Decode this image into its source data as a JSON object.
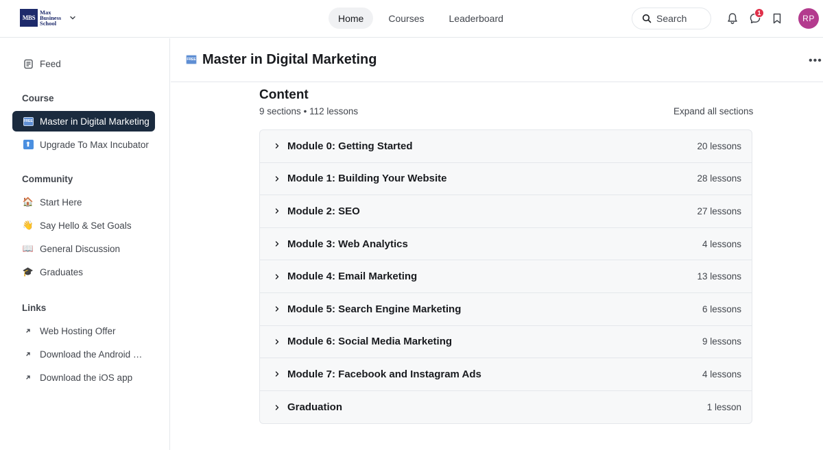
{
  "brand": {
    "logo_abbr": "MBS",
    "logo_text": "Max Business School"
  },
  "nav": {
    "items": [
      "Home",
      "Courses",
      "Leaderboard"
    ],
    "active": "Home"
  },
  "search": {
    "label": "Search"
  },
  "notifications": {
    "messages_badge": "1"
  },
  "user": {
    "initials": "RP"
  },
  "sidebar": {
    "feed_label": "Feed",
    "course_heading": "Course",
    "course_items": [
      {
        "label": "Master in Digital Marketing",
        "icon": "free-tag-icon",
        "active": true
      },
      {
        "label": "Upgrade To Max Incubator",
        "icon": "up-arrow-icon",
        "active": false
      }
    ],
    "community_heading": "Community",
    "community_items": [
      {
        "label": "Start Here",
        "emoji": "🏠"
      },
      {
        "label": "Say Hello & Set Goals",
        "emoji": "👋"
      },
      {
        "label": "General Discussion",
        "emoji": "📖"
      },
      {
        "label": "Graduates",
        "emoji": "🎓"
      }
    ],
    "links_heading": "Links",
    "link_items": [
      {
        "label": "Web Hosting Offer"
      },
      {
        "label": "Download the Android app"
      },
      {
        "label": "Download the iOS app"
      }
    ]
  },
  "page": {
    "title": "Master in Digital Marketing",
    "free_tag": "FREE"
  },
  "content": {
    "title": "Content",
    "sections": "9 sections",
    "separator": "•",
    "lessons": "112 lessons",
    "expand_label": "Expand all sections",
    "modules": [
      {
        "title": "Module 0: Getting Started",
        "count": "20 lessons"
      },
      {
        "title": "Module 1: Building Your Website",
        "count": "28 lessons"
      },
      {
        "title": "Module 2: SEO",
        "count": "27 lessons"
      },
      {
        "title": "Module 3: Web Analytics",
        "count": "4 lessons"
      },
      {
        "title": "Module 4: Email Marketing",
        "count": "13 lessons"
      },
      {
        "title": "Module 5: Search Engine Marketing",
        "count": "6 lessons"
      },
      {
        "title": "Module 6: Social Media Marketing",
        "count": "9 lessons"
      },
      {
        "title": "Module 7: Facebook and Instagram Ads",
        "count": "4 lessons"
      },
      {
        "title": "Graduation",
        "count": "1 lesson"
      }
    ]
  },
  "colors": {
    "active_sidebar": "#1b2b3f",
    "avatar": "#b33b8e",
    "badge": "#e0304a",
    "brand": "#1d2a6b"
  }
}
